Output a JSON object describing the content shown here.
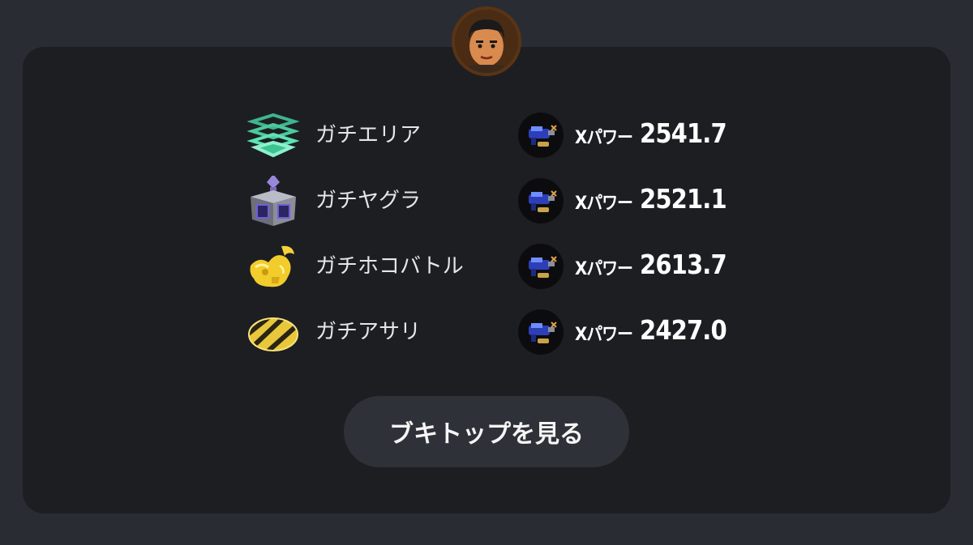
{
  "modes": [
    {
      "name": "ガチエリア",
      "icon": "splat-zones-icon",
      "xpower_label": "Xパワー",
      "xpower": "2541.7"
    },
    {
      "name": "ガチヤグラ",
      "icon": "tower-control-icon",
      "xpower_label": "Xパワー",
      "xpower": "2521.1"
    },
    {
      "name": "ガチホコバトル",
      "icon": "rainmaker-icon",
      "xpower_label": "Xパワー",
      "xpower": "2613.7"
    },
    {
      "name": "ガチアサリ",
      "icon": "clam-blitz-icon",
      "xpower_label": "Xパワー",
      "xpower": "2427.0"
    }
  ],
  "weapon_icon": "blaster-weapon-icon",
  "avatar_icon": "user-avatar-icon",
  "button": {
    "label": "ブキトップを見る"
  },
  "colors": {
    "background": "#2a2c34",
    "card": "#1d1e22",
    "button": "#2f3138",
    "text": "#e6e6e6"
  }
}
